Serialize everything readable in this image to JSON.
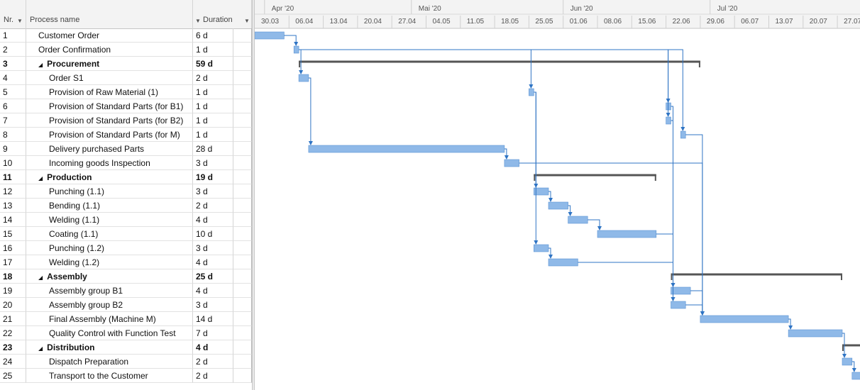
{
  "columns": {
    "nr": "Nr.",
    "name": "Process name",
    "duration": "Duration"
  },
  "timescale": {
    "months": [
      "Apr '20",
      "Mai '20",
      "Jun '20",
      "Jul '20"
    ],
    "weeks": [
      "30.03",
      "06.04",
      "13.04",
      "20.04",
      "27.04",
      "04.05",
      "11.05",
      "18.05",
      "25.05",
      "01.06",
      "08.06",
      "15.06",
      "22.06",
      "29.06",
      "06.07",
      "13.07",
      "20.07",
      "27.07"
    ]
  },
  "tasks": [
    {
      "nr": "1",
      "name": "Customer Order",
      "duration": "6 d",
      "level": 1,
      "summary": false,
      "start": 0,
      "days": 6
    },
    {
      "nr": "2",
      "name": "Order Confirmation",
      "duration": "1 d",
      "level": 1,
      "summary": false,
      "start": 8,
      "days": 1
    },
    {
      "nr": "3",
      "name": "Procurement",
      "duration": "59 d",
      "level": 1,
      "summary": true,
      "start": 9,
      "days": 82
    },
    {
      "nr": "4",
      "name": "Order S1",
      "duration": "2 d",
      "level": 2,
      "summary": false,
      "start": 9,
      "days": 2
    },
    {
      "nr": "5",
      "name": "Provision of Raw Material (1)",
      "duration": "1 d",
      "level": 2,
      "summary": false,
      "start": 56,
      "days": 1
    },
    {
      "nr": "6",
      "name": "Provision of Standard Parts (for B1)",
      "duration": "1 d",
      "level": 2,
      "summary": false,
      "start": 84,
      "days": 1
    },
    {
      "nr": "7",
      "name": "Provision of Standard Parts (for B2)",
      "duration": "1 d",
      "level": 2,
      "summary": false,
      "start": 84,
      "days": 1
    },
    {
      "nr": "8",
      "name": "Provision of Standard Parts (for M)",
      "duration": "1 d",
      "level": 2,
      "summary": false,
      "start": 87,
      "days": 1
    },
    {
      "nr": "9",
      "name": "Delivery purchased Parts",
      "duration": "28 d",
      "level": 2,
      "summary": false,
      "start": 11,
      "days": 40
    },
    {
      "nr": "10",
      "name": "Incoming goods Inspection",
      "duration": "3 d",
      "level": 2,
      "summary": false,
      "start": 51,
      "days": 3
    },
    {
      "nr": "11",
      "name": "Production",
      "duration": "19 d",
      "level": 1,
      "summary": true,
      "start": 57,
      "days": 25
    },
    {
      "nr": "12",
      "name": "Punching (1.1)",
      "duration": "3 d",
      "level": 2,
      "summary": false,
      "start": 57,
      "days": 3
    },
    {
      "nr": "13",
      "name": "Bending (1.1)",
      "duration": "2 d",
      "level": 2,
      "summary": false,
      "start": 60,
      "days": 4
    },
    {
      "nr": "14",
      "name": "Welding (1.1)",
      "duration": "4 d",
      "level": 2,
      "summary": false,
      "start": 64,
      "days": 4
    },
    {
      "nr": "15",
      "name": "Coating (1.1)",
      "duration": "10 d",
      "level": 2,
      "summary": false,
      "start": 70,
      "days": 12
    },
    {
      "nr": "16",
      "name": "Punching (1.2)",
      "duration": "3 d",
      "level": 2,
      "summary": false,
      "start": 57,
      "days": 3
    },
    {
      "nr": "17",
      "name": "Welding (1.2)",
      "duration": "4 d",
      "level": 2,
      "summary": false,
      "start": 60,
      "days": 6
    },
    {
      "nr": "18",
      "name": "Assembly",
      "duration": "25 d",
      "level": 1,
      "summary": true,
      "start": 85,
      "days": 35
    },
    {
      "nr": "19",
      "name": "Assembly group B1",
      "duration": "4 d",
      "level": 2,
      "summary": false,
      "start": 85,
      "days": 4
    },
    {
      "nr": "20",
      "name": "Assembly group B2",
      "duration": "3 d",
      "level": 2,
      "summary": false,
      "start": 85,
      "days": 3
    },
    {
      "nr": "21",
      "name": "Final Assembly (Machine M)",
      "duration": "14 d",
      "level": 2,
      "summary": false,
      "start": 91,
      "days": 18
    },
    {
      "nr": "22",
      "name": "Quality Control with Function Test",
      "duration": "7 d",
      "level": 2,
      "summary": false,
      "start": 109,
      "days": 11
    },
    {
      "nr": "23",
      "name": "Distribution",
      "duration": "4 d",
      "level": 1,
      "summary": true,
      "start": 120,
      "days": 5
    },
    {
      "nr": "24",
      "name": "Dispatch Preparation",
      "duration": "2 d",
      "level": 2,
      "summary": false,
      "start": 120,
      "days": 2
    },
    {
      "nr": "25",
      "name": "Transport to the Customer",
      "duration": "2 d",
      "level": 2,
      "summary": false,
      "start": 122,
      "days": 3
    }
  ],
  "links": [
    [
      "1",
      "2"
    ],
    [
      "2",
      "4"
    ],
    [
      "2",
      "5"
    ],
    [
      "2",
      "6"
    ],
    [
      "2",
      "7"
    ],
    [
      "2",
      "8"
    ],
    [
      "4",
      "9"
    ],
    [
      "9",
      "10"
    ],
    [
      "10",
      "21"
    ],
    [
      "5",
      "12"
    ],
    [
      "5",
      "16"
    ],
    [
      "12",
      "13"
    ],
    [
      "13",
      "14"
    ],
    [
      "14",
      "15"
    ],
    [
      "15",
      "19"
    ],
    [
      "16",
      "17"
    ],
    [
      "17",
      "20"
    ],
    [
      "6",
      "19"
    ],
    [
      "7",
      "20"
    ],
    [
      "8",
      "21"
    ],
    [
      "19",
      "21"
    ],
    [
      "20",
      "21"
    ],
    [
      "21",
      "22"
    ],
    [
      "22",
      "24"
    ],
    [
      "24",
      "25"
    ]
  ],
  "colors": {
    "bar": "#8fb9e8",
    "bar_edge": "#5b93d3",
    "link": "#2f74c4",
    "summary": "#555555",
    "grid_line": "#d4d4d4",
    "header_bg": "#f3f3f3"
  }
}
